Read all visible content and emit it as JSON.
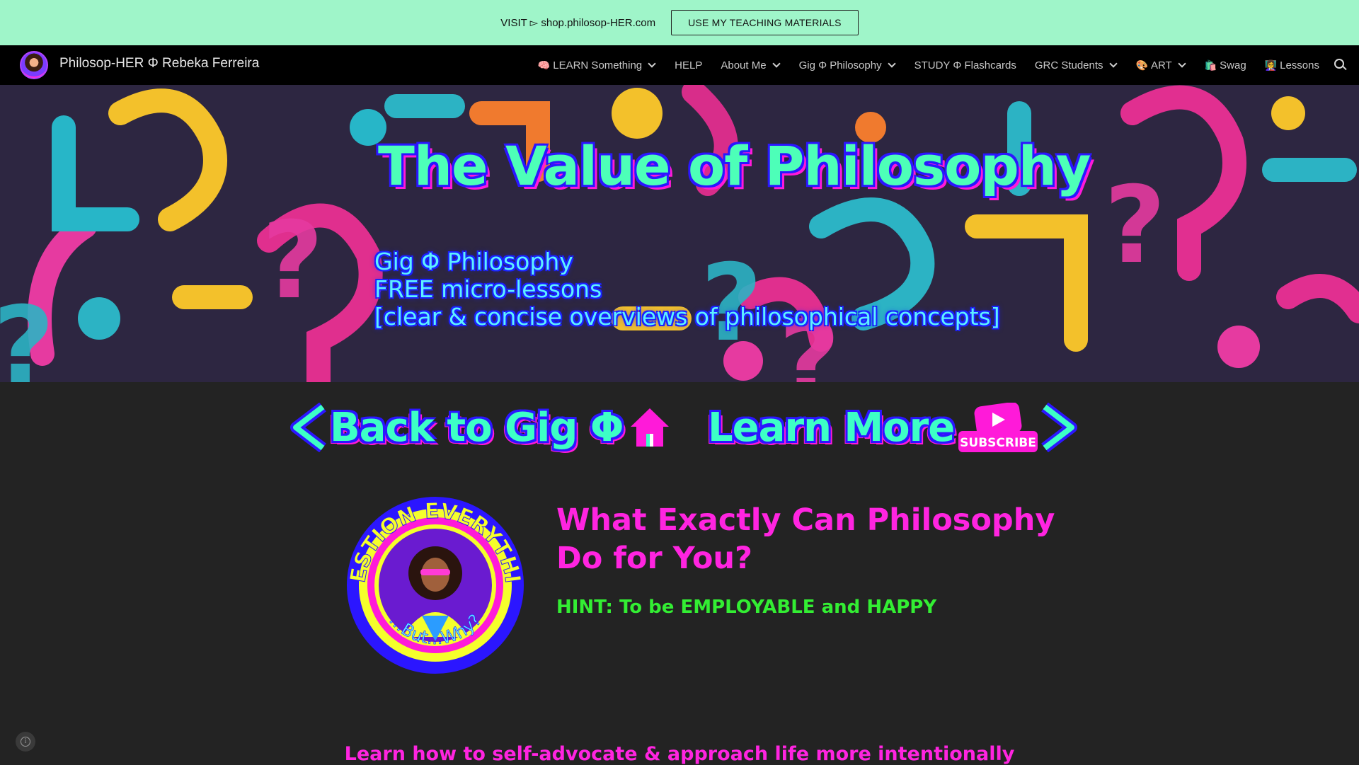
{
  "banner": {
    "text": "VISIT ▻ shop.philosop-HER.com",
    "button_label": "USE MY TEACHING MATERIALS"
  },
  "navbar": {
    "site_title": "Philosop-HER Φ Rebeka Ferreira",
    "items": [
      {
        "icon": "🧠",
        "label": "LEARN Something",
        "dropdown": true
      },
      {
        "icon": "",
        "label": "HELP",
        "dropdown": false
      },
      {
        "icon": "",
        "label": "About Me",
        "dropdown": true
      },
      {
        "icon": "",
        "label": "Gig Φ Philosophy",
        "dropdown": true
      },
      {
        "icon": "",
        "label": "STUDY Φ Flashcards",
        "dropdown": false
      },
      {
        "icon": "",
        "label": "GRC Students",
        "dropdown": true
      },
      {
        "icon": "🎨",
        "label": "ART",
        "dropdown": true
      },
      {
        "icon": "🛍️",
        "label": "Swag",
        "dropdown": false
      },
      {
        "icon": "👩‍🏫",
        "label": "Lessons",
        "dropdown": false
      }
    ]
  },
  "hero": {
    "title": "The Value of Philosophy",
    "subtitle_lines": [
      "Gig Φ Philosophy",
      "FREE micro-lessons",
      "[clear & concise overviews of philosophical concepts]"
    ]
  },
  "actions": {
    "back_label": "Back to Gig Φ",
    "learn_label": "Learn More",
    "subscribe_label": "SUBSCRIBE"
  },
  "badge": {
    "top_text": "QUESTION EVERYTHING",
    "bottom_text": "...But...Why?"
  },
  "content": {
    "heading": "What Exactly Can Philosophy Do for You?",
    "hint": "HINT: To be EMPLOYABLE and HAPPY",
    "bottom_line": "Learn how to self-advocate & approach life more intentionally"
  },
  "colors": {
    "banner_bg": "#9ff5c9",
    "accent_pink": "#ff24e0",
    "accent_green": "#33ee33",
    "accent_mint": "#3dffc6",
    "accent_blue": "#2b16ff"
  }
}
